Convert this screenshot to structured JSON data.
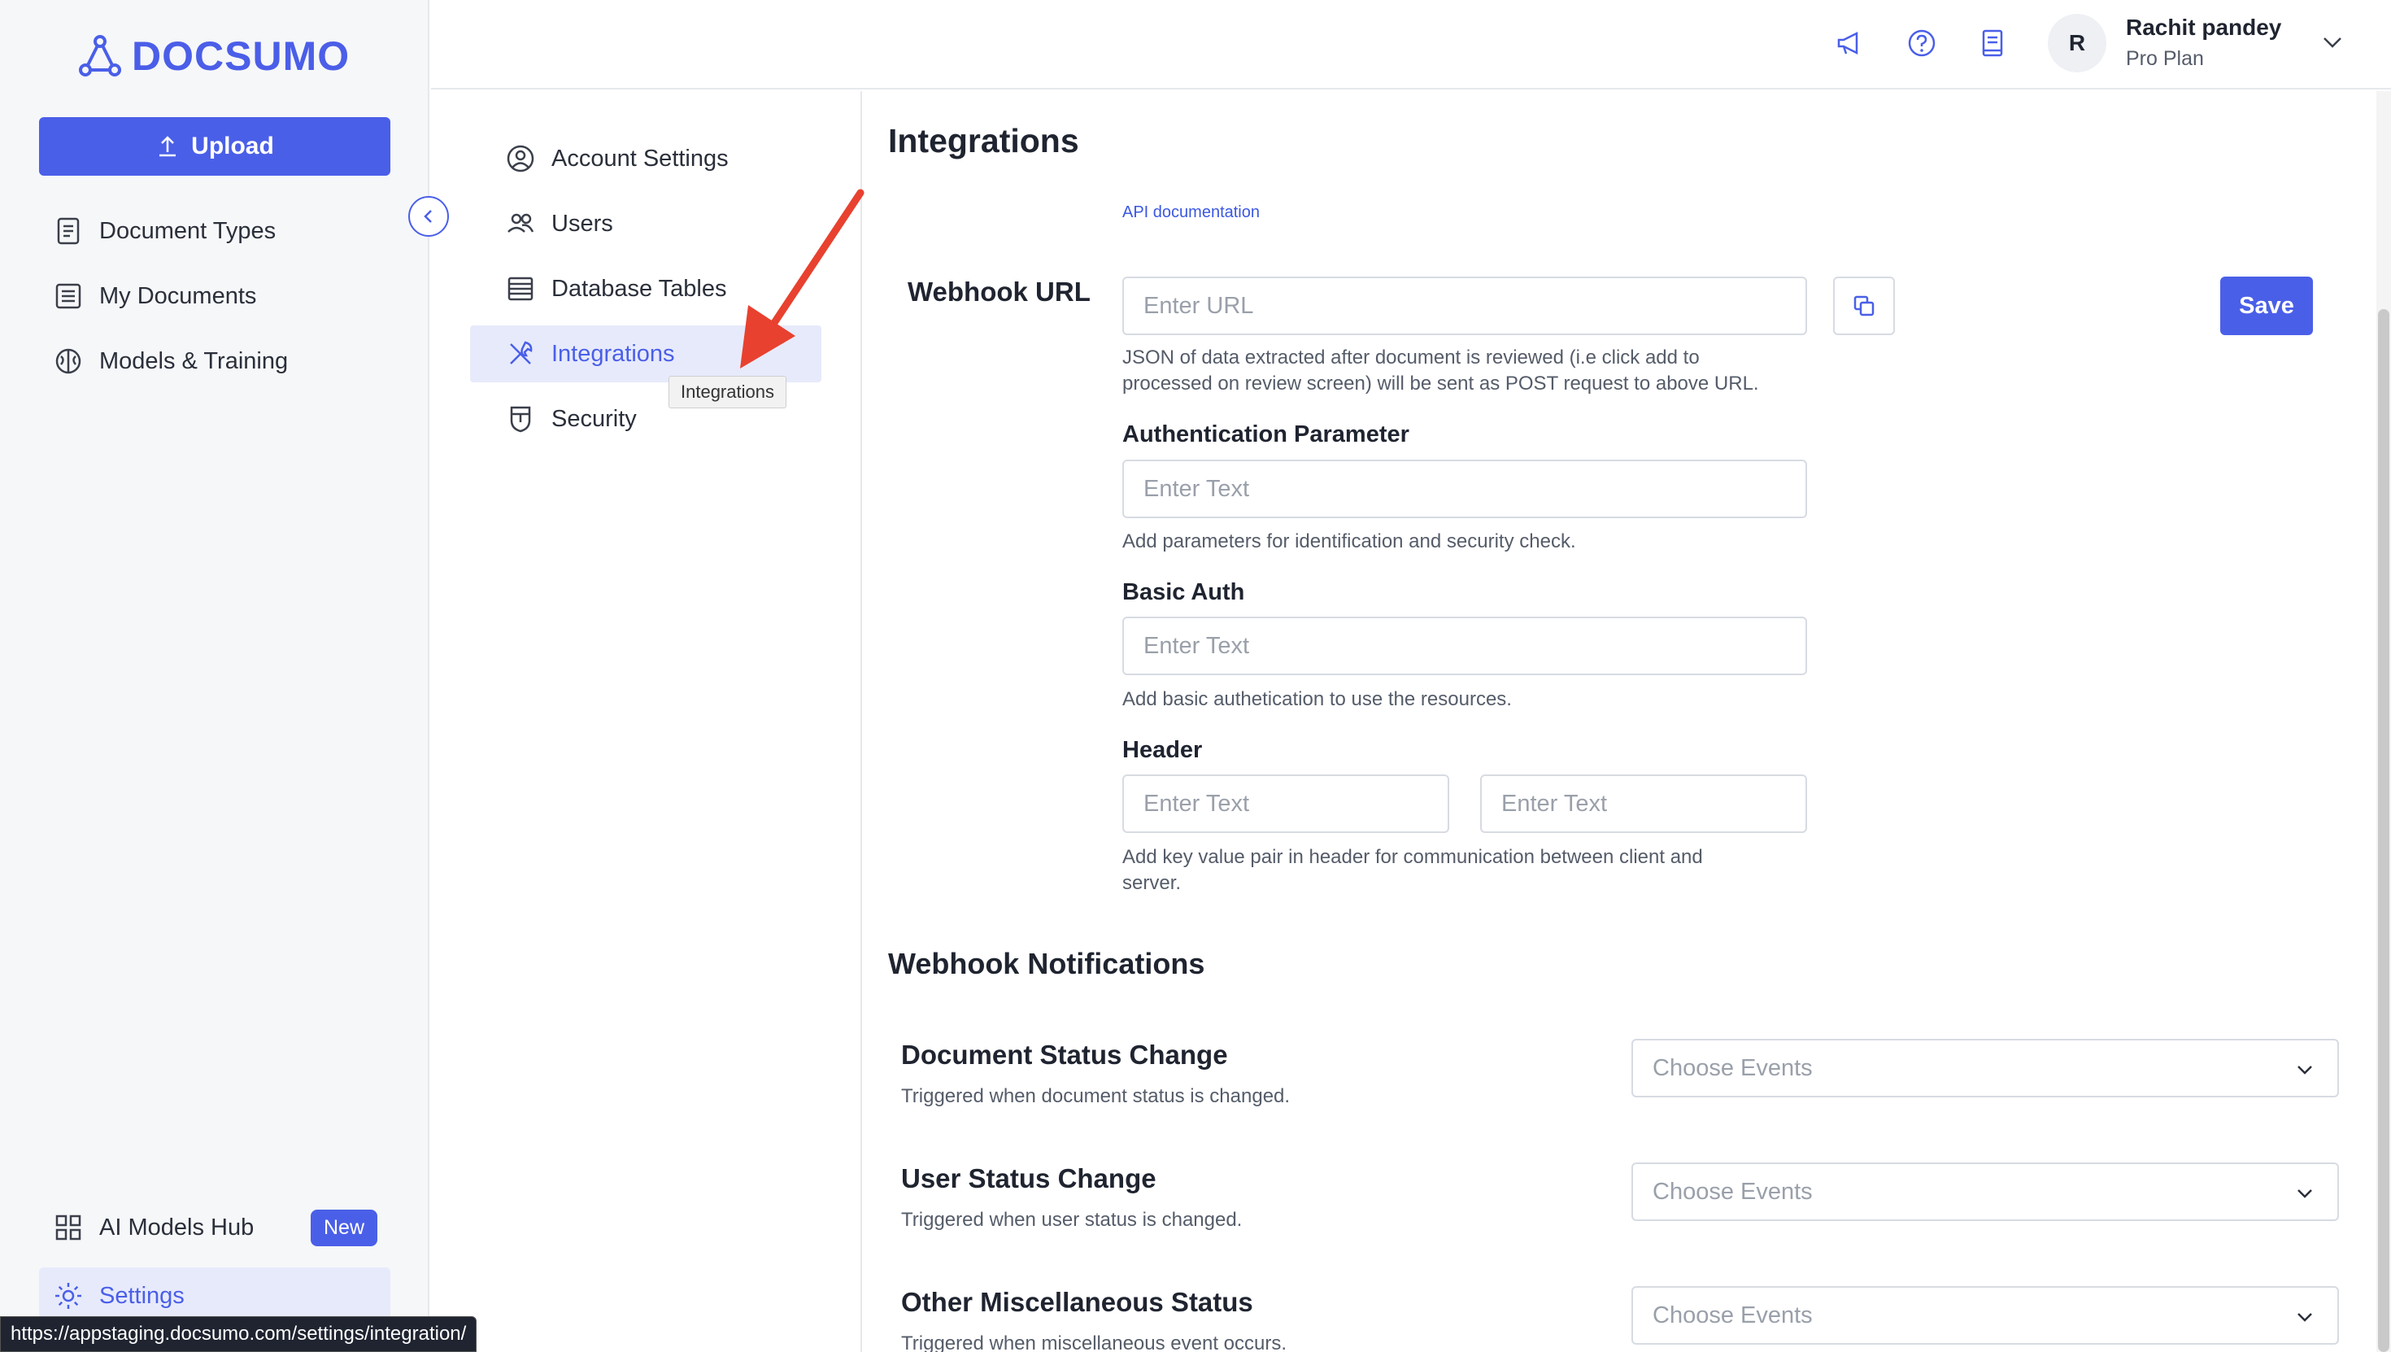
{
  "brand": {
    "name": "DOCSUMO",
    "color": "#4a5fe8"
  },
  "sidebar": {
    "upload_label": "Upload",
    "items": [
      {
        "label": "Document Types",
        "icon": "document-types-icon"
      },
      {
        "label": "My Documents",
        "icon": "my-documents-icon"
      },
      {
        "label": "Models & Training",
        "icon": "brain-icon"
      }
    ],
    "bottom_items": [
      {
        "label": "AI Models Hub",
        "icon": "grid-icon",
        "badge": "New"
      },
      {
        "label": "Settings",
        "icon": "gear-icon",
        "active": true
      }
    ]
  },
  "header": {
    "icons": [
      "megaphone-icon",
      "help-icon",
      "book-icon"
    ],
    "user": {
      "initial": "R",
      "name": "Rachit pandey",
      "plan": "Pro Plan"
    }
  },
  "settings_menu": {
    "items": [
      {
        "label": "Account Settings",
        "icon": "account-icon"
      },
      {
        "label": "Users",
        "icon": "users-icon"
      },
      {
        "label": "Database Tables",
        "icon": "table-icon"
      },
      {
        "label": "Integrations",
        "icon": "tools-icon",
        "active": true
      },
      {
        "label": "Security",
        "icon": "shield-icon"
      }
    ],
    "tooltip": "Integrations"
  },
  "main": {
    "title": "Integrations",
    "api_link": "API documentation",
    "webhook": {
      "label": "Webhook URL",
      "placeholder": "Enter URL",
      "help_line1": "JSON of data extracted after document is reviewed (i.e click add to",
      "help_line2": "processed on review screen) will be sent as POST request to above URL.",
      "save_label": "Save"
    },
    "auth_param": {
      "label": "Authentication Parameter",
      "placeholder": "Enter Text",
      "help": "Add parameters for identification and security check."
    },
    "basic_auth": {
      "label": "Basic Auth",
      "placeholder": "Enter Text",
      "help": "Add basic authetication to use the resources."
    },
    "header_field": {
      "label": "Header",
      "key_placeholder": "Enter Text",
      "value_placeholder": "Enter Text",
      "help_line1": "Add key value pair in header for communication between client and",
      "help_line2": "server."
    },
    "notifications": {
      "title": "Webhook Notifications",
      "items": [
        {
          "title": "Document Status Change",
          "desc": "Triggered when document status is changed.",
          "placeholder": "Choose Events"
        },
        {
          "title": "User Status Change",
          "desc": "Triggered when user status is changed.",
          "placeholder": "Choose Events"
        },
        {
          "title": "Other Miscellaneous Status",
          "desc": "Triggered when miscellaneous event occurs.",
          "placeholder": "Choose Events"
        }
      ]
    }
  },
  "status_url": "https://appstaging.docsumo.com/settings/integration/"
}
